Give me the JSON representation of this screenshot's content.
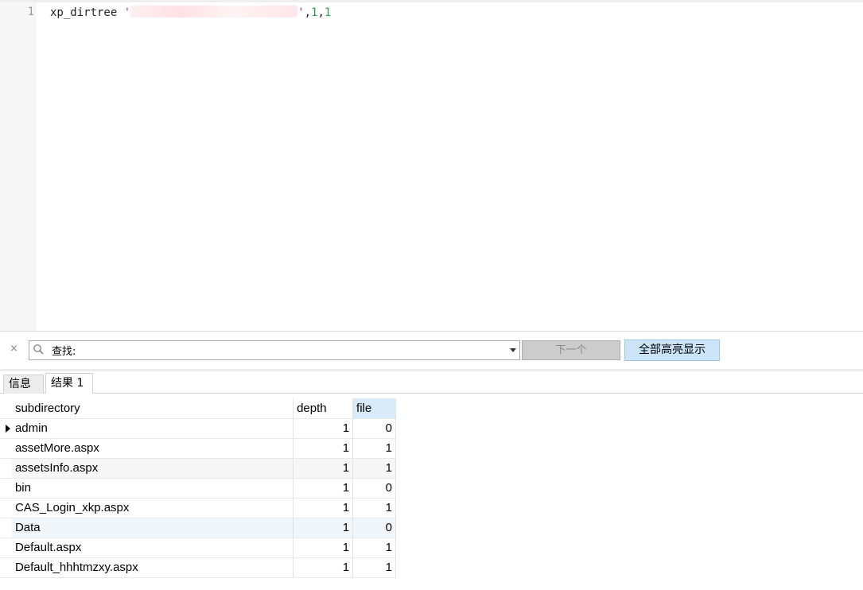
{
  "editor": {
    "line_number": "1",
    "tokens": {
      "ident": "xp_dirtree",
      "quote_open": "'",
      "quote_close": "'",
      "comma1": ",",
      "arg1": "1",
      "comma2": ",",
      "arg2": "1"
    }
  },
  "findbar": {
    "close_label": "×",
    "search_label": "查找:",
    "next_label": "下一个",
    "highlight_all_label": "全部高亮显示"
  },
  "tabs": [
    {
      "label": "信息"
    },
    {
      "label": "结果 1"
    }
  ],
  "grid": {
    "columns": [
      "subdirectory",
      "depth",
      "file"
    ],
    "selected_column": "file",
    "rows": [
      {
        "subdirectory": "admin",
        "depth": "1",
        "file": "0"
      },
      {
        "subdirectory": "assetMore.aspx",
        "depth": "1",
        "file": "1"
      },
      {
        "subdirectory": "assetsInfo.aspx",
        "depth": "1",
        "file": "1"
      },
      {
        "subdirectory": "bin",
        "depth": "1",
        "file": "0"
      },
      {
        "subdirectory": "CAS_Login_xkp.aspx",
        "depth": "1",
        "file": "1"
      },
      {
        "subdirectory": "Data",
        "depth": "1",
        "file": "0"
      },
      {
        "subdirectory": "Default.aspx",
        "depth": "1",
        "file": "1"
      },
      {
        "subdirectory": "Default_hhhtmzxy.aspx",
        "depth": "1",
        "file": "1"
      }
    ]
  },
  "colors": {
    "string_token": "#e0245e",
    "number_token": "#25a24a",
    "highlight_button": "#cce4f7",
    "selected_column_header": "#d9ebf9"
  }
}
